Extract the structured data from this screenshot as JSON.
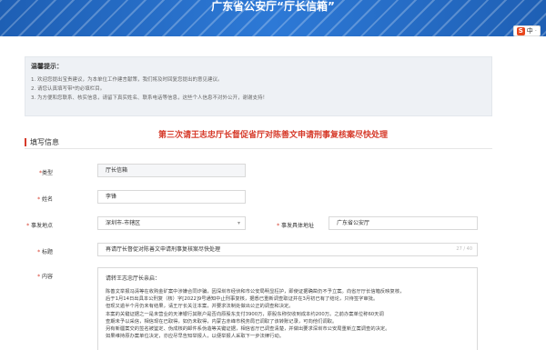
{
  "header": {
    "title": "广东省公安厅“厅长信箱”"
  },
  "ime": {
    "logo": "S",
    "label": "中",
    "dot": "·"
  },
  "tips": {
    "title": "温馨提示：",
    "lines": [
      "1. 欢迎您提出宝贵建议，为本单位工作建言献策，我们将及时回复您提出的意见建议。",
      "2. 请您认真填写带*的必填栏目。",
      "3. 为方便和您联系、核实信息，请留下真实姓名、联系电话等信息，这些个人信息不对外公开，谢谢支持！"
    ]
  },
  "notice": "第三次请王志忠厅长督促省厅对陈善文申请刑事复核案尽快处理",
  "section": {
    "title": "填写信息"
  },
  "form": {
    "type_label": "类型",
    "type_value": "厅长信箱",
    "name_label": "姓名",
    "name_value": "李锋",
    "location_label": "事发地点",
    "location_value": "深圳市-市辖区",
    "unit_label": "事发具体地址",
    "unit_value": "广东省公安厅",
    "subject_label": "标题",
    "subject_value": "再请厅长督促对陈善文申请刑事复核案尽快处理",
    "subject_counter": "27 / 40",
    "content_label": "内容",
    "content_greeting": "请转王志忠厅长亲启：",
    "content_lines": [
      "陈善文举报冯清等在收购金矿案中涉嫌合同诈骗，因深圳市经侦和市公安局明显枉护，即使证据确凿仍不予立案。向省厅厅长信箱反映复核，",
      "后于1月14日出具本公刑复（核）字[2022]9号通知中止刑事复核，据悉已重新调查取证并在3月初已有了结论，只待签字审批。",
      "但现又逾半个月仍未有结果，请王厅长关注本案，并要求法制处做出公正的调查和决定。",
      "本案的关键证据之一是未营业的天津银行其账户是否向原股东支付3900万，原股东称仅收到成本约200万。之前办案单位称60天调",
      "查期未予以采信，相信现在已取得，如仍未取得，内蒙古赤峰市税务局已调取了该转账记录，可向他们调取。",
      "另有新疆案交的签名被鉴定、伪成核的邮件系伪造等关键证据，相信省厅已调查清楚，并做出要求深圳市公安局重新立案调查的决定。",
      "如果维持原办案单位决定，亦应尽早告知举报人，以便举报人采取下一步法律行动。"
    ]
  },
  "colors": {
    "banner": "#2d79d6",
    "accent_red": "#d63a2a",
    "tips_bg": "#eef1f5"
  }
}
